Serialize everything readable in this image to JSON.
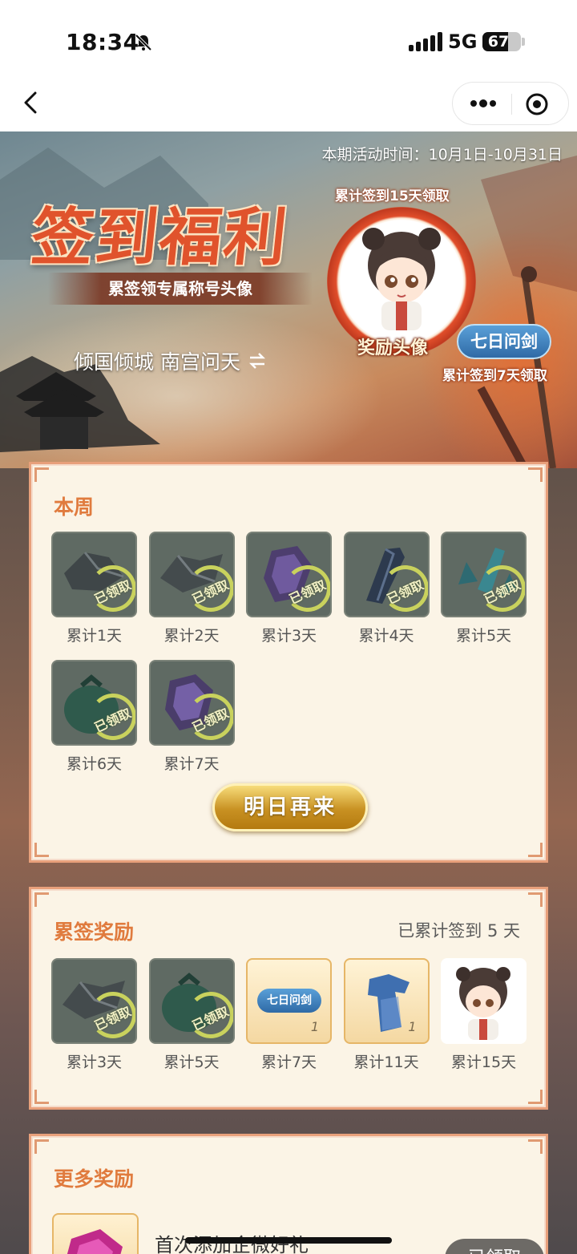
{
  "status_bar": {
    "time": "18:34",
    "network": "5G",
    "battery": "67",
    "battery_level": 0.67,
    "icons": [
      "bell-off-icon",
      "signal-icon",
      "battery-icon"
    ]
  },
  "nav": {
    "icons": [
      "back-icon",
      "more-icon",
      "target-icon"
    ]
  },
  "hero": {
    "period": "本期活动时间：10月1日-10月31日",
    "title": "签到福利",
    "subtitle": "累签领专属称号头像",
    "user": "倾国倾城 南宫问天",
    "avatar_note": "累计签到15天领取",
    "avatar_label": "奖励头像",
    "title_badge": "七日问剑",
    "title_note": "累计签到7天领取"
  },
  "week": {
    "title": "本周",
    "stamp": "已领取",
    "items": [
      {
        "label": "累计1天",
        "icon": "ore-icon"
      },
      {
        "label": "累计2天",
        "icon": "ore-icon"
      },
      {
        "label": "累计3天",
        "icon": "gem-icon"
      },
      {
        "label": "累计4天",
        "icon": "crystal-icon"
      },
      {
        "label": "累计5天",
        "icon": "crystal-icon"
      },
      {
        "label": "累计6天",
        "icon": "bag-icon"
      },
      {
        "label": "累计7天",
        "icon": "gem-icon"
      }
    ],
    "button": "明日再来"
  },
  "cumulative": {
    "title": "累签奖励",
    "progress_text": "已累计签到 5 天",
    "stamp": "已领取",
    "items": [
      {
        "label": "累计3天",
        "claimed": true
      },
      {
        "label": "累计5天",
        "claimed": true
      },
      {
        "label": "累计7天",
        "badge": "七日问剑",
        "qty": "1"
      },
      {
        "label": "累计11天",
        "qty": "1"
      },
      {
        "label": "累计15天"
      }
    ]
  },
  "more": {
    "title": "更多奖励",
    "item_text": "首次添加企微好礼",
    "button": "已领取"
  },
  "colors": {
    "accent": "#e07b3e",
    "card_bg": "#fbf4e6",
    "card_border": "#e8a07b",
    "cta_gold": "#c89122"
  }
}
